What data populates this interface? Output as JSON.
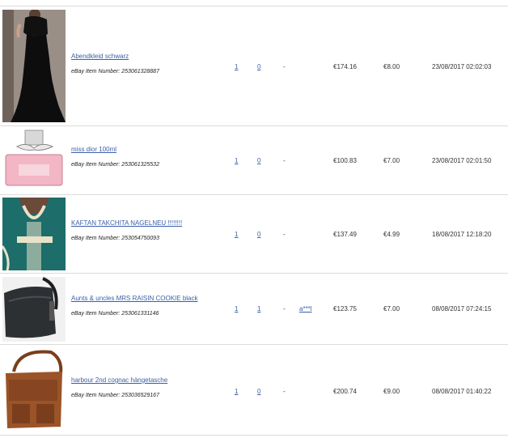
{
  "columns_note": "",
  "listings": [
    {
      "title": "Abendkleid schwarz",
      "item_number": "eBay Item Number: 253061328887",
      "bids": "1",
      "watchers": "0",
      "separator": "-",
      "buyer": "",
      "price": "€174.16",
      "shipping": "€8.00",
      "end_date": "23/08/2017 02:02:03"
    },
    {
      "title": "miss dior 100ml",
      "item_number": "eBay Item Number: 253061325532",
      "bids": "1",
      "watchers": "0",
      "separator": "-",
      "buyer": "",
      "price": "€100.83",
      "shipping": "€7.00",
      "end_date": "23/08/2017 02:01:50"
    },
    {
      "title": "KAFTAN TAKCHITA NAGELNEU !!!!!!!!",
      "item_number": "eBay Item Number: 253054750093",
      "bids": "1",
      "watchers": "0",
      "separator": "-",
      "buyer": "",
      "price": "€137.49",
      "shipping": "€4.99",
      "end_date": "18/08/2017 12:18:20"
    },
    {
      "title": "Aunts & uncles MRS RAISIN COOKIE black",
      "item_number": "eBay Item Number: 253061331146",
      "bids": "1",
      "watchers": "1",
      "separator": "-",
      "buyer": "a***l",
      "price": "€123.75",
      "shipping": "€7.00",
      "end_date": "08/08/2017 07:24:15"
    },
    {
      "title": "harbour 2nd cognac hängetasche",
      "item_number": "eBay Item Number: 253036529167",
      "bids": "1",
      "watchers": "0",
      "separator": "-",
      "buyer": "",
      "price": "€200.74",
      "shipping": "€9.00",
      "end_date": "08/08/2017 01:40:22"
    }
  ],
  "thumbnails": [
    {
      "icon": "black-evening-dress-photo"
    },
    {
      "icon": "perfume-bottle-photo"
    },
    {
      "icon": "teal-kaftan-photo"
    },
    {
      "icon": "black-leather-bag-photo"
    },
    {
      "icon": "cognac-leather-bag-photo"
    }
  ],
  "colors": {
    "link": "#3a5fa8",
    "divider": "#dcdcdc"
  }
}
